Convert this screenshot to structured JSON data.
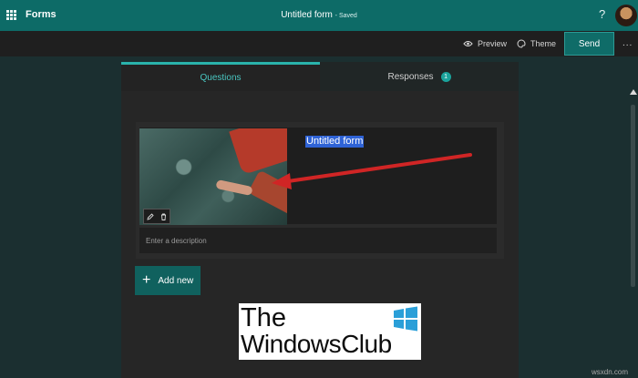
{
  "app": {
    "name": "Forms"
  },
  "document": {
    "title": "Untitled form",
    "status": "Saved"
  },
  "header": {
    "help_icon": "?"
  },
  "command_bar": {
    "preview_label": "Preview",
    "theme_label": "Theme",
    "send_label": "Send",
    "more_label": "..."
  },
  "tabs": [
    {
      "label": "Questions"
    },
    {
      "label": "Responses",
      "badge": "1"
    }
  ],
  "form": {
    "title": "Untitled form",
    "description_placeholder": "Enter a description"
  },
  "actions": {
    "add_new_label": "Add new"
  },
  "watermark": {
    "line1": "The",
    "line2": "WindowsClub"
  },
  "credit": "wsxdn.com",
  "colors": {
    "header_bg": "#0d6b67",
    "accent": "#2ab3ac",
    "page_bg": "#1b2f30",
    "annotation_arrow": "#d02525"
  }
}
